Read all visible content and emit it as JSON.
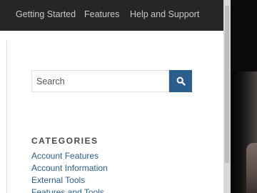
{
  "nav": {
    "items": [
      {
        "label": "Getting Started"
      },
      {
        "label": "Features"
      },
      {
        "label": "Help and Support"
      }
    ]
  },
  "search": {
    "placeholder": "Search",
    "button_icon": "search-icon"
  },
  "categories": {
    "heading": "CATEGORIES",
    "items": [
      {
        "label": "Account Features"
      },
      {
        "label": "Account Information"
      },
      {
        "label": "External Tools"
      },
      {
        "label": "Features and Tools"
      }
    ]
  },
  "colors": {
    "nav_bg": "#262626",
    "accent": "#2a5e8c",
    "link": "#2a5e8c"
  }
}
